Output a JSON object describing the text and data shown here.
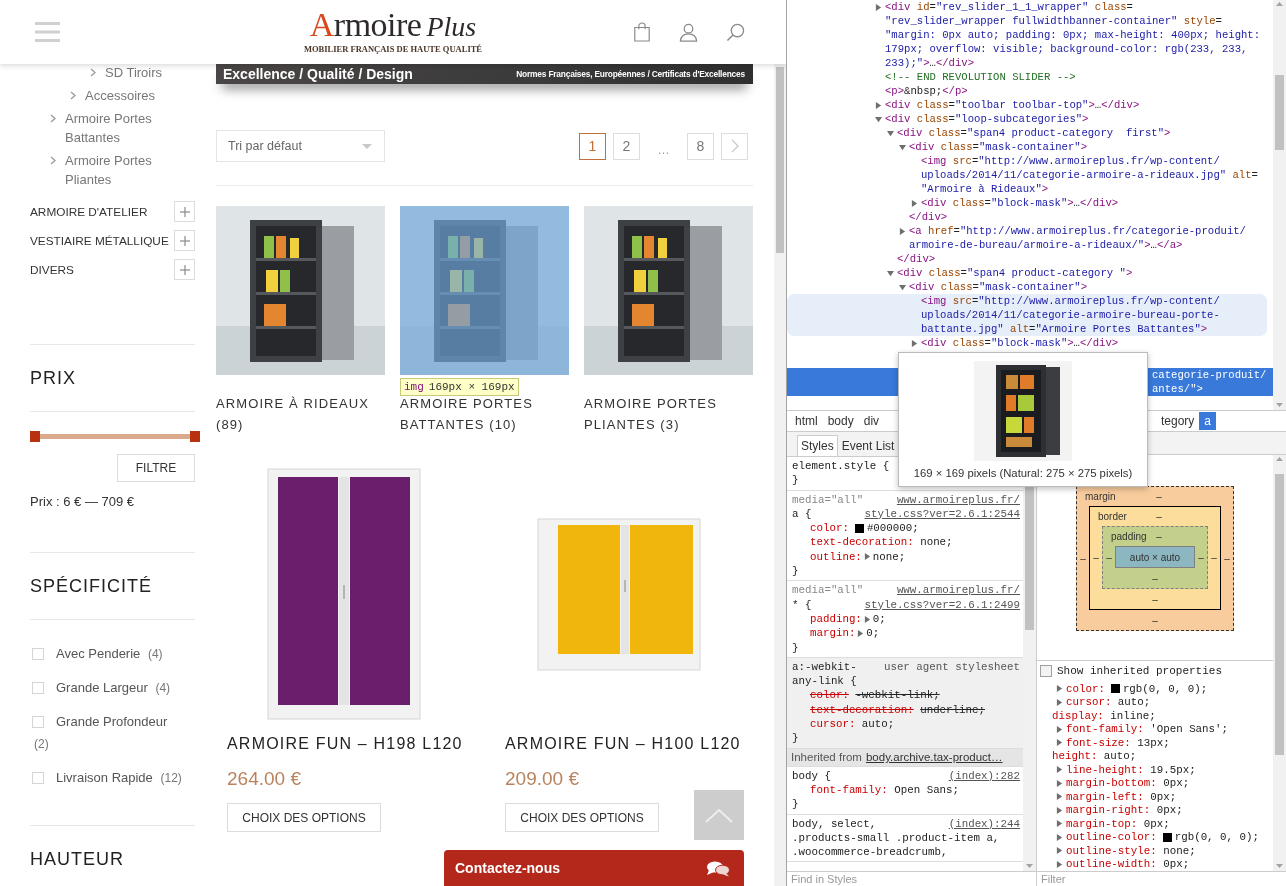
{
  "site": {
    "header": {
      "logo": {
        "name": "Armoire",
        "suffix": "Plus",
        "tagline": "MOBILIER FRANÇAIS DE HAUTE QUALITÉ"
      }
    },
    "banner": {
      "title": "Excellence / Qualité / Design",
      "subtitle": "Normes Françaises, Européennes / Certificats d'Excellences"
    },
    "sidebar": {
      "categories": [
        {
          "children": [
            {
              "children": [
                {
                  "children": [
                    {
                      "label": "SD Tiroirs"
                    }
                  ]
                },
                {
                  "label": "Accessoires"
                }
              ]
            },
            {
              "label": "Armoire Portes Battantes"
            },
            {
              "label": "Armoire Portes Pliantes"
            }
          ]
        },
        {
          "label": "ARMOIRE D'ATELIER",
          "expanded": false
        },
        {
          "label": "VESTIAIRE MÉTALLIQUE",
          "expanded": false
        },
        {
          "label": "DIVERS",
          "expanded": false
        }
      ],
      "price_filter": {
        "title": "PRIX",
        "range": {
          "level": 1
        },
        "button": "FILTRE",
        "summary": "Prix : 6 € — 709 €"
      },
      "feature_filter": {
        "title": "SPÉCIFICITÉ",
        "options": [
          {
            "label": "Avec Penderie",
            "count": "(4)",
            "checked": false
          },
          {
            "label": "Grande Largeur",
            "count": "(4)",
            "checked": false
          },
          {
            "label": "Grande Profondeur",
            "count": "(2)",
            "checked": false
          },
          {
            "label": "Livraison Rapide",
            "count": "(12)",
            "checked": false
          }
        ]
      },
      "height_filter": {
        "title": "HAUTEUR"
      }
    },
    "toolbar": {
      "sort": {
        "value": "Tri par défaut"
      },
      "pagination": [
        {
          "kind": "page",
          "label": "1",
          "selected": true
        },
        {
          "kind": "page",
          "label": "2",
          "selected": false
        },
        {
          "kind": "ellipsis",
          "label": "…",
          "selected": false
        },
        {
          "kind": "page",
          "label": "8",
          "selected": false
        },
        {
          "kind": "next",
          "selected": false
        }
      ]
    },
    "subcategories": [
      {
        "title": "ARMOIRE À RIDEAUX (89)",
        "inspected": false
      },
      {
        "title": "ARMOIRE PORTES BATTANTES (10)",
        "inspected": true,
        "tooltip": {
          "tag": "img",
          "size": "169px × 169px"
        }
      },
      {
        "title": "ARMOIRE PORTES PLIANTES (3)",
        "inspected": false
      }
    ],
    "products": [
      {
        "kind": "tall",
        "title": "ARMOIRE FUN – H198 L120",
        "price": "264.00 €",
        "button": "CHOIX DES OPTIONS",
        "color": "#6a1f6d"
      },
      {
        "kind": "low",
        "title": "ARMOIRE FUN – H100 L120",
        "price": "209.00 €",
        "button": "CHOIX DES OPTIONS",
        "color": "#f1b60c"
      }
    ],
    "contact_bar": {
      "label": "Contactez-nous"
    }
  },
  "devtools": {
    "dom_tree": [
      {
        "lines": [
          "<div id=\"rev_slider_1_1_wrapper\" class=",
          "\"rev_slider_wrapper fullwidthbanner-container\" style=",
          "\"margin: 0px auto; padding: 0px; max-height: 400px; height:",
          "179px; overflow: visible; background-color: rgb(233, 233,",
          "233);\">…</div>"
        ],
        "expanded": false,
        "selected": false,
        "hovered": false
      },
      {
        "lines": [
          "<!-- END REVOLUTION SLIDER -->"
        ],
        "selected": false,
        "hovered": false
      },
      {
        "lines": [
          "<p>&nbsp;</p>"
        ],
        "selected": false,
        "hovered": false
      },
      {
        "lines": [
          "<div class=\"toolbar toolbar-top\">…</div>"
        ],
        "expanded": false,
        "selected": false,
        "hovered": false
      },
      {
        "lines": [
          "<div class=\"loop-subcategories\">"
        ],
        "expanded": true,
        "selected": false,
        "hovered": false,
        "children": [
          {
            "lines": [
              "<div class=\"span4 product-category  first\">"
            ],
            "expanded": true,
            "selected": false,
            "hovered": false,
            "close": "</div>",
            "children": [
              {
                "lines": [
                  "<div class=\"mask-container\">"
                ],
                "expanded": true,
                "selected": false,
                "hovered": false,
                "close": "</div>",
                "children": [
                  {
                    "lines": [
                      "<img src=\"http://www.armoireplus.fr/wp-content/",
                      "uploads/2014/11/categorie-armoire-a-rideaux.jpg\" alt=",
                      "\"Armoire à Rideaux\">"
                    ],
                    "selected": false,
                    "hovered": false
                  },
                  {
                    "lines": [
                      "<div class=\"block-mask\">…</div>"
                    ],
                    "expanded": false,
                    "selected": false,
                    "hovered": false
                  }
                ]
              },
              {
                "lines": [
                  "<a href=\"http://www.armoireplus.fr/categorie-produit/",
                  "armoire-de-bureau/armoire-a-rideaux/\">…</a>"
                ],
                "expanded": false,
                "selected": false,
                "hovered": false
              }
            ]
          },
          {
            "lines": [
              "<div class=\"span4 product-category \">"
            ],
            "expanded": true,
            "selected": false,
            "hovered": false,
            "children": [
              {
                "lines": [
                  "<div class=\"mask-container\">"
                ],
                "expanded": true,
                "selected": false,
                "hovered": false,
                "children": [
                  {
                    "lines": [
                      "<img src=\"http://www.armoireplus.fr/wp-content/",
                      "uploads/2014/11/categorie-armoire-bureau-porte-",
                      "battante.jpg\" alt=\"Armoire Portes Battantes\">"
                    ],
                    "selected": false,
                    "hovered": true
                  },
                  {
                    "lines": [
                      "<div class=\"block-mask\">…</div>"
                    ],
                    "expanded": false,
                    "selected": false,
                    "hovered": false
                  }
                ]
              },
              {
                "lines": [
                  "categorie-produit/",
                  "antes/\">"
                ],
                "selected": true,
                "hovered": false
              }
            ]
          }
        ]
      }
    ],
    "image_preview": {
      "caption": "169 × 169 pixels (Natural: 275 × 275 pixels)"
    },
    "breadcrumbs": [
      {
        "label": "html",
        "selected": false
      },
      {
        "label": "body",
        "selected": false
      },
      {
        "label": "div",
        "selected": false
      },
      {
        "label": "tegory",
        "selected": false
      },
      {
        "label": "a",
        "selected": true
      }
    ],
    "panel_tabs": [
      {
        "label": "Styles",
        "selected": true
      },
      {
        "label": "Event List",
        "selected": false
      }
    ],
    "style_rules": [
      {
        "kind": "rule",
        "header": [
          {
            "kind": "selector",
            "text": "element.style {"
          }
        ],
        "closing": "}"
      },
      {
        "kind": "rule",
        "header": [
          {
            "kind": "media",
            "text": "media=\"all\"",
            "source": "www.armoireplus.fr/"
          },
          {
            "kind": "selector",
            "text": "a {",
            "source": "style.css?ver=2.6.1:2544"
          }
        ],
        "declarations": [
          {
            "name": "color:",
            "value": "#000000;",
            "color": "#000000",
            "overridden": false
          },
          {
            "name": "text-decoration:",
            "value": "none;",
            "overridden": false
          },
          {
            "name": "outline:",
            "value": "none;",
            "expanded": false,
            "overridden": false
          }
        ],
        "closing": "}"
      },
      {
        "kind": "rule",
        "header": [
          {
            "kind": "media",
            "text": "media=\"all\"",
            "source": "www.armoireplus.fr/"
          },
          {
            "kind": "selector",
            "text": "* {",
            "source": "style.css?ver=2.6.1:2499"
          }
        ],
        "declarations": [
          {
            "name": "padding:",
            "value": "0;",
            "expanded": false,
            "overridden": false
          },
          {
            "name": "margin:",
            "value": "0;",
            "expanded": false,
            "overridden": false
          }
        ],
        "closing": "}"
      },
      {
        "kind": "user_agent",
        "header": [
          {
            "kind": "selector",
            "text": "a:-webkit-",
            "source": "user agent stylesheet"
          },
          {
            "kind": "selector",
            "text": "any-link {"
          }
        ],
        "declarations": [
          {
            "name": "color:",
            "value": "-webkit-link;",
            "overridden": true
          },
          {
            "name": "text-decoration:",
            "value": "underline;",
            "overridden": true
          },
          {
            "name": "cursor:",
            "value": "auto;",
            "overridden": false
          }
        ],
        "closing": "}"
      },
      {
        "kind": "inherited",
        "label": "Inherited from",
        "link": "body.archive.tax-product…"
      },
      {
        "kind": "rule",
        "header": [
          {
            "kind": "selector",
            "text": "body {",
            "source": "(index):282"
          }
        ],
        "declarations": [
          {
            "name": "font-family:",
            "value": "Open Sans;",
            "overridden": false
          }
        ],
        "closing": "}"
      },
      {
        "kind": "rule",
        "header": [
          {
            "kind": "selector",
            "text": "body, select,",
            "source": "(index):244"
          },
          {
            "kind": "selector",
            "text": ".products-small .product-item a,"
          },
          {
            "kind": "selector",
            "text": ".woocommerce-breadcrumb,"
          }
        ]
      }
    ],
    "find_field": {
      "placeholder": "Find in Styles"
    },
    "box_model": {
      "margin": {
        "label": "margin",
        "top": "–",
        "right": "–",
        "bottom": "–",
        "left": "–"
      },
      "border": {
        "label": "border",
        "top": "–",
        "right": "–",
        "bottom": "–",
        "left": "–"
      },
      "padding": {
        "label": "padding",
        "top": "–",
        "right": "–",
        "bottom": "–",
        "left": "–"
      },
      "content": "auto × auto"
    },
    "show_inherited": {
      "label": "Show inherited properties",
      "checked": false
    },
    "computed": [
      {
        "name": "color:",
        "value": "rgb(0, 0, 0);",
        "color": "#000000",
        "expanded": false
      },
      {
        "name": "cursor:",
        "value": "auto;",
        "expanded": false
      },
      {
        "name": "display:",
        "value": "inline;"
      },
      {
        "name": "font-family:",
        "value": "'Open Sans';",
        "expanded": false
      },
      {
        "name": "font-size:",
        "value": "13px;",
        "expanded": false
      },
      {
        "name": "height:",
        "value": "auto;"
      },
      {
        "name": "line-height:",
        "value": "19.5px;",
        "expanded": false
      },
      {
        "name": "margin-bottom:",
        "value": "0px;",
        "expanded": false
      },
      {
        "name": "margin-left:",
        "value": "0px;",
        "expanded": false
      },
      {
        "name": "margin-right:",
        "value": "0px;",
        "expanded": false
      },
      {
        "name": "margin-top:",
        "value": "0px;",
        "expanded": false
      },
      {
        "name": "outline-color:",
        "value": "rgb(0, 0, 0);",
        "color": "#000000",
        "expanded": false
      },
      {
        "name": "outline-style:",
        "value": "none;",
        "expanded": false
      },
      {
        "name": "outline-width:",
        "value": "0px;",
        "expanded": false
      }
    ],
    "filter_field": {
      "placeholder": "Filter"
    }
  }
}
